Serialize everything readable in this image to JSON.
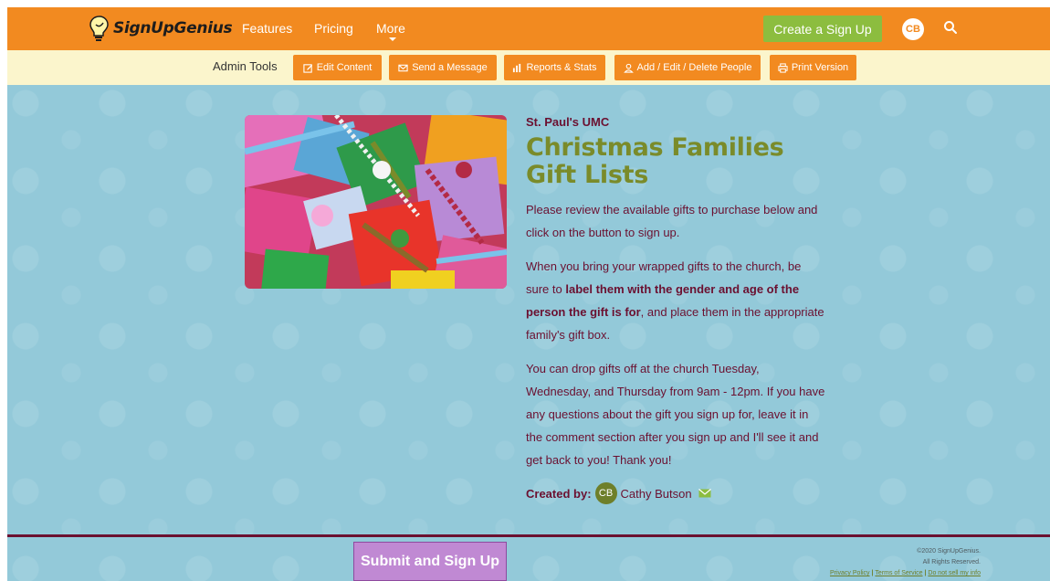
{
  "brand": {
    "name": "SignUpGenius"
  },
  "nav": {
    "links": [
      "Features",
      "Pricing",
      "More"
    ],
    "create_label": "Create a Sign Up",
    "avatar_initials": "CB",
    "icons": {
      "search": "search-icon",
      "more": "chevron-down-icon"
    }
  },
  "admin": {
    "label": "Admin Tools",
    "buttons": [
      {
        "label": "Edit Content",
        "icon": "edit-icon"
      },
      {
        "label": "Send a Message",
        "icon": "envelope-icon"
      },
      {
        "label": "Reports & Stats",
        "icon": "chart-icon"
      },
      {
        "label": "Add / Edit / Delete People",
        "icon": "person-icon"
      },
      {
        "label": "Print Version",
        "icon": "printer-icon"
      }
    ]
  },
  "signup": {
    "org": "St. Paul's UMC",
    "title_line1": "Christmas Families",
    "title_line2": "Gift Lists",
    "para1": "Please review the available gifts to purchase below and click on the button to sign up.",
    "para2_before": "When you bring your wrapped gifts to the church, be sure to ",
    "para2_bold": "label them with the gender and age of the person the gift is for",
    "para2_after": ", and place them in the appropriate family's gift box.",
    "para3": "You can drop gifts off at the church Tuesday, Wednesday, and Thursday from 9am - 12pm. If you have any questions about the gift you sign up for, leave it in the comment section after you sign up and I'll see it and get back to you! Thank you!",
    "created_label": "Created by:",
    "creator_initials": "CB",
    "creator_name": "Cathy Butson"
  },
  "footer": {
    "submit_label": "Submit and Sign Up",
    "copyright": "©2020 SignUpGenius.",
    "rights": "All Rights Reserved.",
    "privacy": "Privacy Policy",
    "terms": "Terms of Service",
    "dnsmi": "Do not sell my info",
    "sep": " | "
  },
  "colors": {
    "nav": "#f28a20",
    "admin_bar": "#fbf5cc",
    "background": "#93c9d9",
    "title": "#7a8b2a",
    "text": "#6b1030",
    "create_button": "#8cbd3f",
    "submit_button": "#c089d3"
  }
}
